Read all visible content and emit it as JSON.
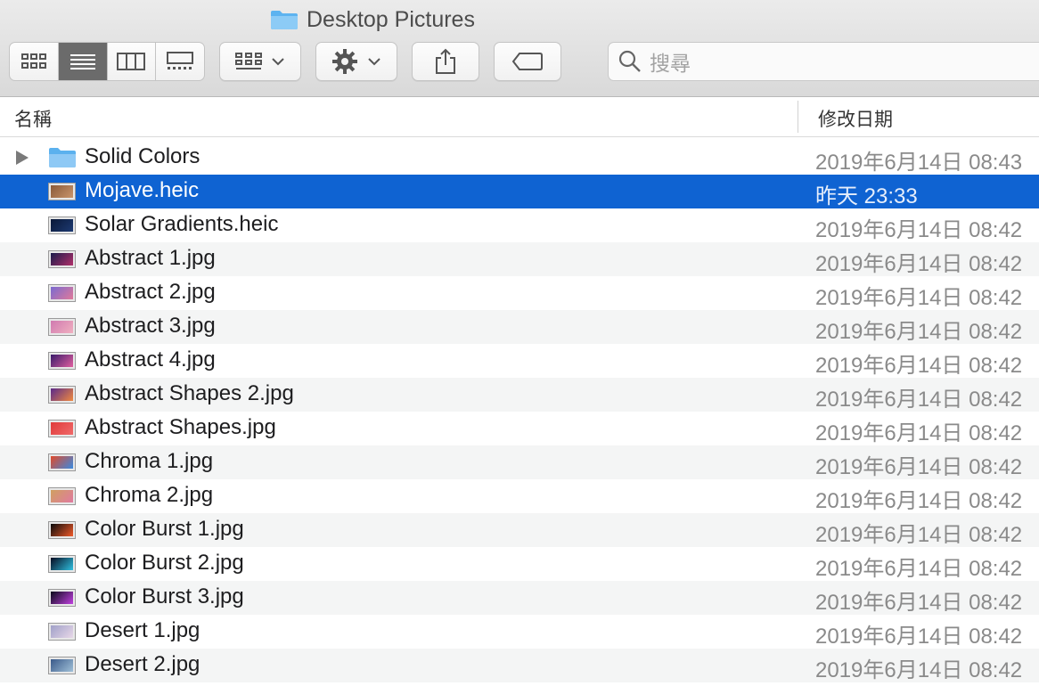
{
  "window": {
    "title": "Desktop Pictures"
  },
  "toolbar": {
    "view_modes": [
      "icon-view",
      "list-view",
      "column-view",
      "gallery-view"
    ],
    "active_view": "list-view",
    "search_placeholder": "搜尋"
  },
  "columns": {
    "name": "名稱",
    "date_modified": "修改日期"
  },
  "files": [
    {
      "name": "Solid Colors",
      "date": "2019年6月14日 08:43",
      "kind": "folder",
      "colors": [
        "#8ec9f5",
        "#5bb1ee"
      ]
    },
    {
      "name": "Mojave.heic",
      "date": "昨天 23:33",
      "kind": "image",
      "selected": true,
      "colors": [
        "#8a5a3a",
        "#c9946a"
      ]
    },
    {
      "name": "Solar Gradients.heic",
      "date": "2019年6月14日 08:42",
      "kind": "image",
      "colors": [
        "#0a1838",
        "#1d3a72"
      ]
    },
    {
      "name": "Abstract 1.jpg",
      "date": "2019年6月14日 08:42",
      "kind": "image",
      "colors": [
        "#1a1a4a",
        "#b0306a"
      ]
    },
    {
      "name": "Abstract 2.jpg",
      "date": "2019年6月14日 08:42",
      "kind": "image",
      "colors": [
        "#7a6ad0",
        "#e07a9a"
      ]
    },
    {
      "name": "Abstract 3.jpg",
      "date": "2019年6月14日 08:42",
      "kind": "image",
      "colors": [
        "#d07ab0",
        "#f0b0c0"
      ]
    },
    {
      "name": "Abstract 4.jpg",
      "date": "2019年6月14日 08:42",
      "kind": "image",
      "colors": [
        "#3a1a6a",
        "#e060a0"
      ]
    },
    {
      "name": "Abstract Shapes 2.jpg",
      "date": "2019年6月14日 08:42",
      "kind": "image",
      "colors": [
        "#5a2a8a",
        "#f08a40"
      ]
    },
    {
      "name": "Abstract Shapes.jpg",
      "date": "2019年6月14日 08:42",
      "kind": "image",
      "colors": [
        "#e03a3a",
        "#f06a6a"
      ]
    },
    {
      "name": "Chroma 1.jpg",
      "date": "2019年6月14日 08:42",
      "kind": "image",
      "colors": [
        "#e04a2a",
        "#3a8ae0"
      ]
    },
    {
      "name": "Chroma 2.jpg",
      "date": "2019年6月14日 08:42",
      "kind": "image",
      "colors": [
        "#d0a060",
        "#e07aa0"
      ]
    },
    {
      "name": "Color Burst 1.jpg",
      "date": "2019年6月14日 08:42",
      "kind": "image",
      "colors": [
        "#0a0a0a",
        "#f05a2a"
      ]
    },
    {
      "name": "Color Burst 2.jpg",
      "date": "2019年6月14日 08:42",
      "kind": "image",
      "colors": [
        "#050a20",
        "#30c0e0"
      ]
    },
    {
      "name": "Color Burst 3.jpg",
      "date": "2019年6月14日 08:42",
      "kind": "image",
      "colors": [
        "#0a0a1a",
        "#c040e0"
      ]
    },
    {
      "name": "Desert 1.jpg",
      "date": "2019年6月14日 08:42",
      "kind": "image",
      "colors": [
        "#a0a0c8",
        "#e8d8e8"
      ]
    },
    {
      "name": "Desert 2.jpg",
      "date": "2019年6月14日 08:42",
      "kind": "image",
      "colors": [
        "#3a5a8a",
        "#a0c0d8"
      ]
    }
  ],
  "colors": {
    "selection": "#0f63d2",
    "alt_row": "#f4f5f5",
    "folder_blue": "#6cbcf3"
  }
}
